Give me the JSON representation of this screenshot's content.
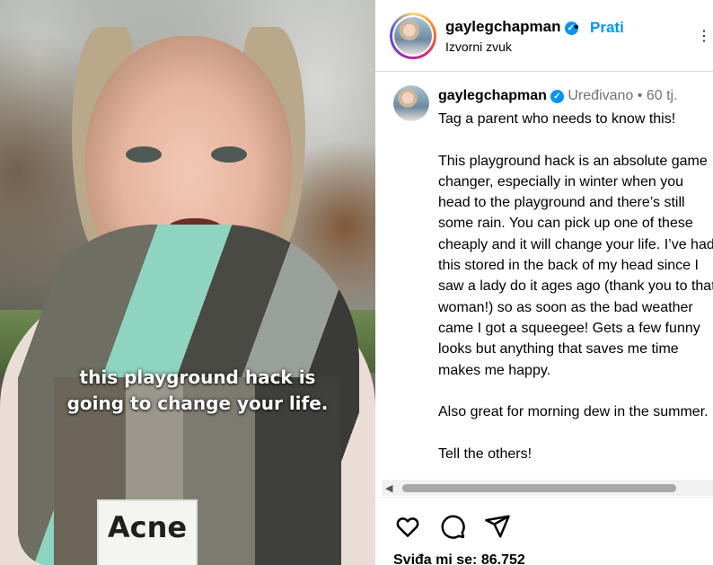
{
  "video": {
    "caption_line1": "this playground hack is",
    "caption_line2": "going to change your life.",
    "scarf_label": "Acne"
  },
  "header": {
    "username": "gaylegchapman",
    "separator": "•",
    "follow_label": "Prati",
    "audio_label": "Izvorni zvuk",
    "more_icon": "more-icon"
  },
  "comment": {
    "username": "gaylegchapman",
    "edited_label": "Uređivano",
    "separator": "•",
    "age": "60 tj.",
    "body": "Tag a parent who needs to know this!\n\nThis playground hack is an absolute game changer, especially in winter when you head to the playground and there’s still some rain. You can pick up one of these cheaply and it will change your life. I’ve had this stored in the back of my head since I saw a lady do it ages ago (thank you to that woman!) so as soon as the bad weather came I got a squeegee! Gets a few funny looks but anything that saves me time makes me happy.\n\nAlso great for morning dew in the summer.\n\nTell the others!"
  },
  "actions": {
    "like_icon": "heart-icon",
    "comment_icon": "comment-icon",
    "share_icon": "share-icon",
    "likes_text": "Sviđa mi se: 86.752"
  },
  "colors": {
    "accent": "#0095f6",
    "muted": "#737373",
    "divider": "#dbdbdb"
  }
}
